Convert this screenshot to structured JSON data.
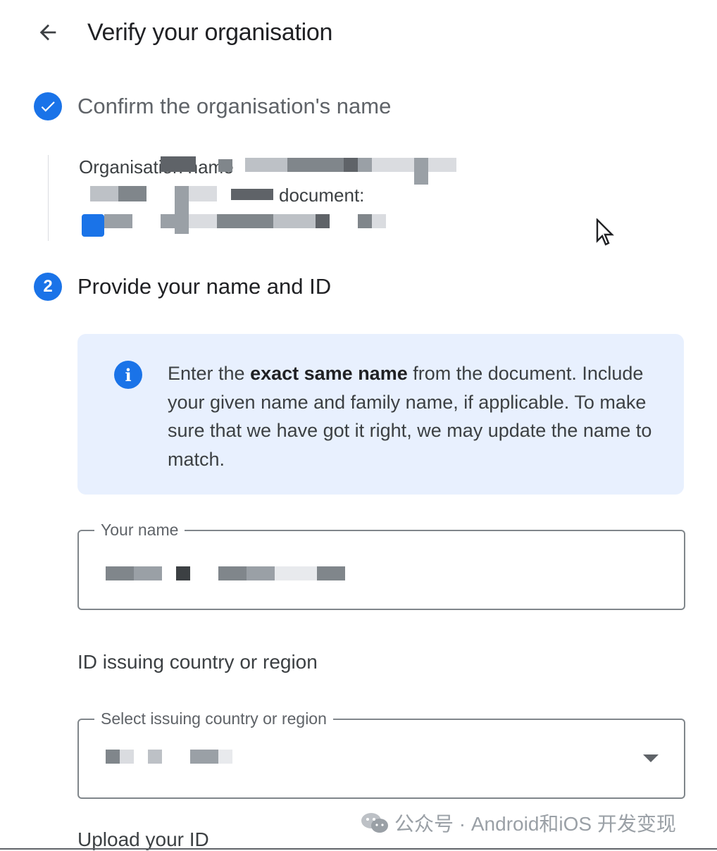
{
  "header": {
    "back_icon": "arrow-back-icon",
    "title": "Verify your organisation"
  },
  "step1": {
    "status": "completed",
    "icon": "check-circle-icon",
    "title": "Confirm the organisation's name",
    "org_name_label": "Organisation name",
    "document_label": "document:",
    "redacted": true
  },
  "step2": {
    "number": "2",
    "title": "Provide your name and ID",
    "info": {
      "icon": "info-icon",
      "text_before": "Enter the ",
      "text_bold": "exact same name",
      "text_after": " from the document. Include your given name and family name, if applicable. To make sure that we have got it right, we may update the name to match."
    },
    "name_field": {
      "label": "Your name",
      "value_redacted": true
    },
    "country_section_label": "ID issuing country or region",
    "country_field": {
      "label": "Select issuing country or region",
      "value_redacted": true,
      "dropdown_icon": "arrow-drop-down-icon"
    },
    "upload_label": "Upload your ID"
  },
  "watermark": {
    "icon": "wechat-icon",
    "text": "公众号 · Android和iOS 开发变现"
  },
  "colors": {
    "accent": "#1a73e8",
    "info_bg": "#e8f0fe",
    "text_primary": "#202124",
    "text_secondary": "#5f6368",
    "border": "#80868b"
  }
}
